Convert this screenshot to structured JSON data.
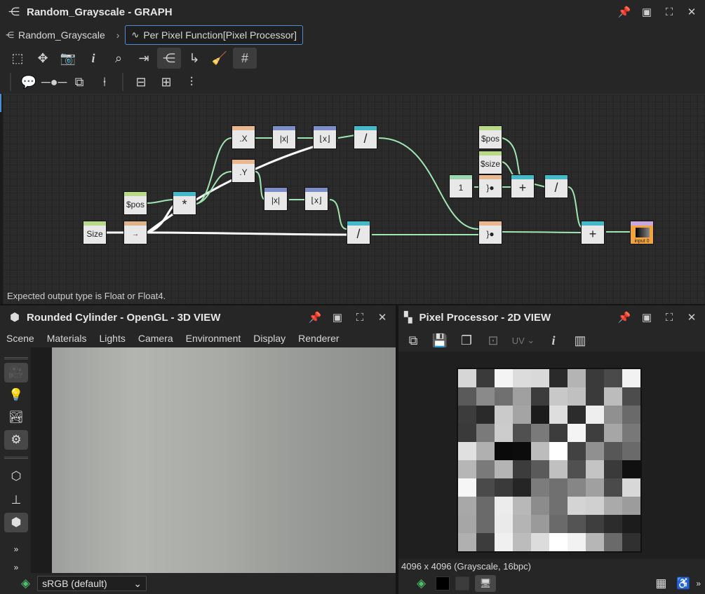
{
  "graph": {
    "title": "Random_Grayscale - GRAPH",
    "breadcrumb": [
      "Random_Grayscale",
      "Per Pixel Function[Pixel Processor]"
    ],
    "status": "Expected output type is Float or Float4.",
    "nodes": {
      "size": "Size",
      "pos1": "$pos",
      "mul": "*",
      "swz_x": ".X",
      "swz_y": ".Y",
      "abs1": "|x|",
      "abs2": "|x|",
      "floor1": "⌊x⌋",
      "floor2": "⌊x⌋",
      "div1": "/",
      "div2": "/",
      "pos2": "$pos",
      "size2": "$size",
      "const1": "1",
      "add1": "+",
      "div3": "/",
      "add2": "+",
      "output": "input 0"
    }
  },
  "view3d": {
    "title": "Rounded Cylinder - OpenGL - 3D VIEW",
    "menu": [
      "Scene",
      "Materials",
      "Lights",
      "Camera",
      "Environment",
      "Display",
      "Renderer"
    ],
    "colorspace": "sRGB (default)"
  },
  "view2d": {
    "title": "Pixel Processor - 2D VIEW",
    "uv_label": "UV",
    "info": "4096 x 4096 (Grayscale, 16bpc)",
    "pixels": [
      [
        "#d6d6d6",
        "#3a3a3a",
        "#f4f4f4",
        "#dcdcdc",
        "#d9d9d9",
        "#2a2a2a",
        "#b4b4b4",
        "#3a3a3a",
        "#4a4a4a",
        "#f2f2f2"
      ],
      [
        "#5a5a5a",
        "#8a8a8a",
        "#707070",
        "#a0a0a0",
        "#3c3c3c",
        "#c8c8c8",
        "#c0c0c0",
        "#3a3a3a",
        "#bcbcbc",
        "#4c4c4c"
      ],
      [
        "#3c3c3c",
        "#2a2a2a",
        "#cacaca",
        "#a4a4a4",
        "#1c1c1c",
        "#dedede",
        "#2c2c2c",
        "#eeeeee",
        "#909090",
        "#6a6a6a"
      ],
      [
        "#3a3a3a",
        "#7a7a7a",
        "#cccccc",
        "#505050",
        "#7a7a7a",
        "#3c3c3c",
        "#f4f4f4",
        "#3e3e3e",
        "#a6a6a6",
        "#787878"
      ],
      [
        "#e0e0e0",
        "#b0b0b0",
        "#0a0a0a",
        "#0c0c0c",
        "#bcbcbc",
        "#ffffff",
        "#424242",
        "#909090",
        "#575757",
        "#6a6a6a"
      ],
      [
        "#b6b6b6",
        "#7a7a7a",
        "#b4b4b4",
        "#3c3c3c",
        "#5a5a5a",
        "#c0c0c0",
        "#505050",
        "#c4c4c4",
        "#3a3a3a",
        "#101010"
      ],
      [
        "#f6f6f6",
        "#4a4a4a",
        "#3a3a3a",
        "#252525",
        "#7c7c7c",
        "#707070",
        "#868686",
        "#a0a0a0",
        "#4a4a4a",
        "#d8d8d8"
      ],
      [
        "#a8a8a8",
        "#6a6a6a",
        "#ececec",
        "#b8b8b8",
        "#8c8c8c",
        "#707070",
        "#d4d4d4",
        "#d0d0d0",
        "#aaaaaa",
        "#9c9c9c"
      ],
      [
        "#a6a6a6",
        "#6a6a6a",
        "#eaeaea",
        "#b4b4b4",
        "#9a9a9a",
        "#6a6a6a",
        "#545454",
        "#3e3e3e",
        "#2c2c2c",
        "#1c1c1c"
      ],
      [
        "#b0b0b0",
        "#3c3c3c",
        "#f0f0f0",
        "#bcbcbc",
        "#dcdcdc",
        "#ffffff",
        "#f2f2f2",
        "#b6b6b6",
        "#6a6a6a",
        "#303030"
      ]
    ]
  },
  "colors": {
    "accent": "#4a8fd6",
    "wire_green": "#9fe6b0",
    "output_node": "#f2a33c"
  }
}
